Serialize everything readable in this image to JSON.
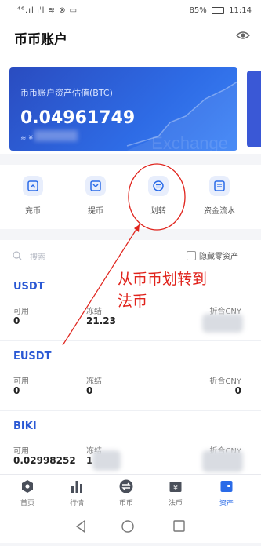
{
  "status": {
    "left": "⁴⁶.ıl ᵢᴵl ≋ ⊗ ▭",
    "battery": "85%",
    "time": "11:14"
  },
  "header": {
    "title": "币币账户"
  },
  "card": {
    "label": "币币账户资产估值(BTC)",
    "value": "0.04961749",
    "approx": "≈ ¥",
    "watermark": "Exchange"
  },
  "actions": [
    {
      "label": "充币",
      "icon": "deposit-icon"
    },
    {
      "label": "提币",
      "icon": "withdraw-icon"
    },
    {
      "label": "划转",
      "icon": "transfer-icon"
    },
    {
      "label": "资金流水",
      "icon": "ledger-icon"
    }
  ],
  "search": {
    "placeholder": "搜索",
    "hide_zero": "隐藏零资产"
  },
  "columns": {
    "available": "可用",
    "frozen": "冻结",
    "cny": "折合CNY"
  },
  "coins": [
    {
      "name": "USDT",
      "available": "0",
      "frozen": "21.23",
      "cny": ""
    },
    {
      "name": "EUSDT",
      "available": "0",
      "frozen": "0",
      "cny": "0"
    },
    {
      "name": "BIKI",
      "available": "0.02998252",
      "frozen": "1",
      "cny": ""
    }
  ],
  "annotation": {
    "line1": "从币币划转到",
    "line2": "法币",
    "color": "#e0231c"
  },
  "tabs": [
    {
      "label": "首页",
      "icon": "home-icon"
    },
    {
      "label": "行情",
      "icon": "market-icon"
    },
    {
      "label": "币币",
      "icon": "exchange-icon"
    },
    {
      "label": "法币",
      "icon": "fiat-icon"
    },
    {
      "label": "资产",
      "icon": "assets-icon",
      "active": true
    }
  ],
  "colors": {
    "accent": "#2a6be8",
    "card": "#2e6be5",
    "annotation": "#e0231c"
  }
}
